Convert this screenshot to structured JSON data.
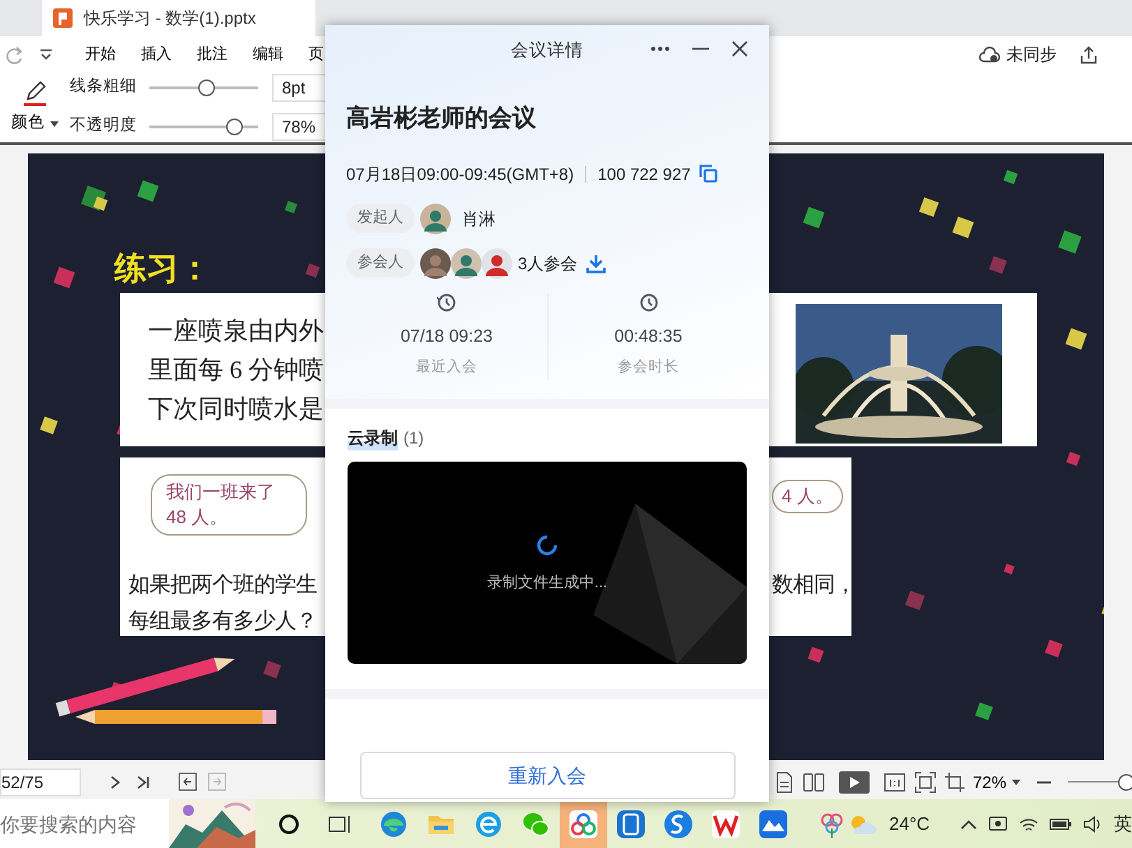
{
  "app_tabs": [
    {
      "label": "快乐学习 - 数学(1).pptx",
      "selected": true
    }
  ],
  "menu": [
    "开始",
    "插入",
    "批注",
    "编辑",
    "页"
  ],
  "sync_status": "未同步",
  "pen_tools": {
    "color_label": "颜色",
    "line_width": {
      "label": "线条粗细",
      "level": 0.52,
      "value": "8pt"
    },
    "opacity": {
      "label": "不透明度",
      "level": 0.78,
      "value": "78%"
    }
  },
  "slide": {
    "title": "练习：",
    "problem_lines": [
      "一座喷泉由内外",
      "里面每 6 分钟喷",
      "下次同时喷水是"
    ],
    "bubble_left": "我们一班来了 48 人。",
    "bubble_right": "4 人。",
    "question_lines": [
      "如果把两个班的学生",
      "每组最多有多少人？"
    ],
    "question_right": "数相同，"
  },
  "status_bar": {
    "page": "52/75",
    "zoom": "72%"
  },
  "taskbar": {
    "search_placeholder": "你要搜索的内容",
    "weather": "24°C",
    "ime": "英"
  },
  "taskbar_apps": [
    {
      "selected": false
    },
    {
      "selected": false
    },
    {
      "selected": false
    },
    {
      "selected": false
    },
    {
      "selected": true
    },
    {
      "selected": false
    },
    {
      "selected": false
    },
    {
      "selected": false
    },
    {
      "selected": false
    }
  ],
  "dialog": {
    "title": "会议详情",
    "meeting_title": "高岩彬老师的会议",
    "time": "07月18日09:00-09:45(GMT+8)",
    "meeting_id": "100 722 927",
    "host": {
      "label": "发起人",
      "name": "肖淋"
    },
    "participants": {
      "label": "参会人",
      "summary": "3人参会"
    },
    "stats": [
      {
        "kind": "history",
        "value": "07/18 09:23",
        "label": "最近入会"
      },
      {
        "kind": "clock",
        "value": "00:48:35",
        "label": "参会时长"
      }
    ],
    "recording": {
      "title": "云录制",
      "count": "(1)",
      "status": "录制文件生成中..."
    },
    "rejoin_button": "重新入会"
  }
}
